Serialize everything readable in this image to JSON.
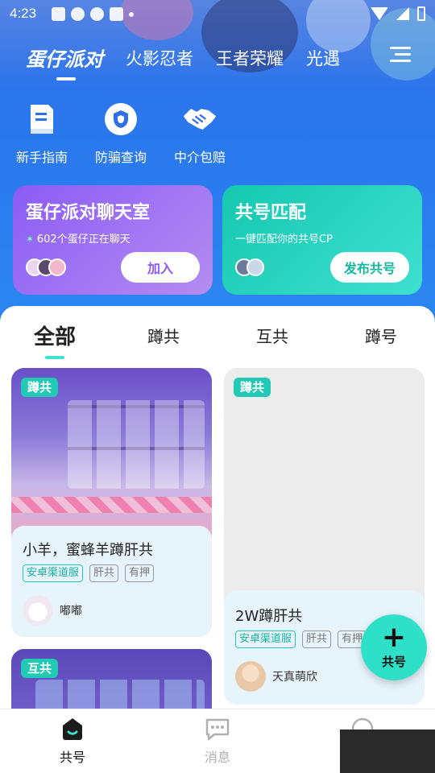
{
  "status_bar": {
    "time": "4:23"
  },
  "game_tabs": [
    "蛋仔派对",
    "火影忍者",
    "王者荣耀",
    "光遇"
  ],
  "quick_links": [
    {
      "label": "新手指南",
      "icon": "book-icon"
    },
    {
      "label": "防骗查询",
      "icon": "shield-icon"
    },
    {
      "label": "中介包赔",
      "icon": "handshake-icon"
    }
  ],
  "chat_card": {
    "title": "蛋仔派对聊天室",
    "subtitle": "602个蛋仔正在聊天",
    "button": "加入"
  },
  "match_card": {
    "title": "共号匹配",
    "subtitle": "一键匹配你的共号CP",
    "button": "发布共号"
  },
  "filter_tabs": [
    "全部",
    "蹲共",
    "互共",
    "蹲号"
  ],
  "posts": [
    {
      "badge": "蹲共",
      "title": "小羊，蜜蜂羊蹲肝共",
      "tags": [
        "安卓渠道服",
        "肝共",
        "有押"
      ],
      "author": "嘟嘟"
    },
    {
      "badge": "蹲共",
      "title": "2W蹲肝共",
      "tags": [
        "安卓渠道服",
        "肝共",
        "有押"
      ],
      "author": "天真萌欣"
    },
    {
      "badge": "互共"
    }
  ],
  "fab": {
    "label": "共号"
  },
  "bottom_nav": [
    {
      "label": "共号",
      "icon": "home-icon"
    },
    {
      "label": "消息",
      "icon": "message-icon"
    }
  ],
  "colors": {
    "primary_blue": "#2f6fe8",
    "accent_teal": "#22c9b4",
    "chat_purple": "#8b5cf6"
  }
}
